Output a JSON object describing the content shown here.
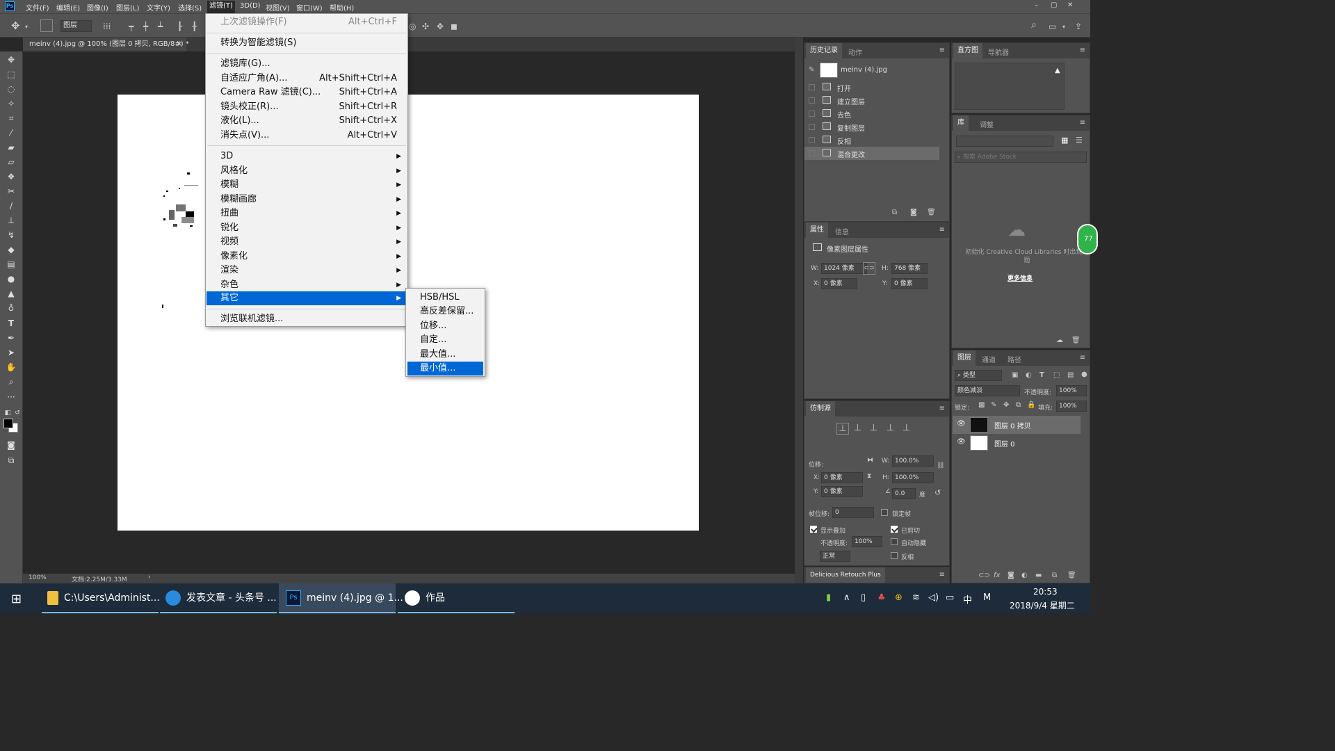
{
  "menubar": {
    "app_icon": "Ps",
    "items": [
      "文件(F)",
      "编辑(E)",
      "图像(I)",
      "图层(L)",
      "文字(Y)",
      "选择(S)",
      "滤镜(T)",
      "3D(D)",
      "视图(V)",
      "窗口(W)",
      "帮助(H)"
    ],
    "active": "滤镜(T)",
    "window_buttons": [
      "–",
      "▢",
      "✕"
    ]
  },
  "options_bar": {
    "layer_select": "图层"
  },
  "document": {
    "tab_title": "meinv (4).jpg @ 100% (图层 0 拷贝, RGB/8#) *",
    "tab_close": "×",
    "zoom": "100%",
    "doc_info": "文档:2.25M/3.33M",
    "status_arrow": "›"
  },
  "filter_menu": {
    "items": [
      {
        "label": "上次滤镜操作(F)",
        "shortcut": "Alt+Ctrl+F",
        "disabled": true
      },
      {
        "label": "转换为智能滤镜(S)",
        "shortcut": ""
      },
      {
        "label": "滤镜库(G)...",
        "shortcut": ""
      },
      {
        "label": "自适应广角(A)...",
        "shortcut": "Alt+Shift+Ctrl+A"
      },
      {
        "label": "Camera Raw 滤镜(C)...",
        "shortcut": "Shift+Ctrl+A"
      },
      {
        "label": "镜头校正(R)...",
        "shortcut": "Shift+Ctrl+R"
      },
      {
        "label": "液化(L)...",
        "shortcut": "Shift+Ctrl+X"
      },
      {
        "label": "消失点(V)...",
        "shortcut": "Alt+Ctrl+V"
      },
      {
        "label": "3D",
        "submenu": true
      },
      {
        "label": "风格化",
        "submenu": true
      },
      {
        "label": "模糊",
        "submenu": true
      },
      {
        "label": "模糊画廊",
        "submenu": true
      },
      {
        "label": "扭曲",
        "submenu": true
      },
      {
        "label": "锐化",
        "submenu": true
      },
      {
        "label": "视频",
        "submenu": true
      },
      {
        "label": "像素化",
        "submenu": true
      },
      {
        "label": "渲染",
        "submenu": true
      },
      {
        "label": "杂色",
        "submenu": true
      },
      {
        "label": "其它",
        "submenu": true,
        "highlighted": true
      },
      {
        "label": "浏览联机滤镜...",
        "shortcut": ""
      }
    ]
  },
  "other_submenu": {
    "items": [
      "HSB/HSL",
      "高反差保留...",
      "位移...",
      "自定...",
      "最大值...",
      "最小值..."
    ],
    "highlighted": "最小值..."
  },
  "history_panel": {
    "tabs": [
      "历史记录",
      "动作"
    ],
    "snapshot": "meinv (4).jpg",
    "steps": [
      "打开",
      "建立图层",
      "去色",
      "复制图层",
      "反相",
      "混合更改"
    ],
    "selected": "混合更改"
  },
  "histogram_panel": {
    "tabs": [
      "直方图",
      "导航器"
    ],
    "warning": "▲"
  },
  "library_panel": {
    "tabs": [
      "库",
      "调整"
    ],
    "search_placeholder": "搜索 Adobe Stock",
    "message": "初始化 Creative Cloud Libraries 时出现问题",
    "more_info": "更多信息"
  },
  "properties_panel": {
    "tabs": [
      "属性",
      "信息"
    ],
    "title": "像素图层属性",
    "w_label": "W:",
    "w_value": "1024 像素",
    "h_label": "H:",
    "h_value": "768 像素",
    "x_label": "X:",
    "x_value": "0 像素",
    "y_label": "Y:",
    "y_value": "0 像素"
  },
  "clone_panel": {
    "tab": "仿制源",
    "offset_label": "位移:",
    "x_label": "X:",
    "x_value": "0 像素",
    "y_label": "Y:",
    "y_value": "0 像素",
    "w_label": "W:",
    "w_value": "100.0%",
    "h_label": "H:",
    "h_value": "100.0%",
    "angle_value": "0.0",
    "angle_unit": "度",
    "frame_offset_label": "帧位移:",
    "frame_offset_value": "0",
    "lock_frame": "锁定帧",
    "show_overlay": "显示叠加",
    "clipped": "已剪切",
    "opacity_label": "不透明度:",
    "opacity_value": "100%",
    "auto_hide": "自动隐藏",
    "mode": "正常",
    "invert": "反相"
  },
  "delicious_panel": {
    "title": "Delicious Retouch Plus"
  },
  "layers_panel": {
    "tabs": [
      "图层",
      "通道",
      "路径"
    ],
    "filter_kind": "类型",
    "blend_mode": "颜色减淡",
    "opacity_label": "不透明度:",
    "opacity_value": "100%",
    "lock_label": "锁定:",
    "fill_label": "填充:",
    "fill_value": "100%",
    "layers": [
      {
        "name": "图层 0 拷贝",
        "selected": true
      },
      {
        "name": "图层 0",
        "selected": false
      }
    ],
    "footer_icons": [
      "link-icon",
      "fx-icon",
      "mask-icon",
      "adjustment-icon",
      "folder-icon",
      "new-layer-icon",
      "trash-icon"
    ]
  },
  "side_badge": "77",
  "taskbar": {
    "items": [
      {
        "label": "C:\\Users\\Administ...",
        "icon": "folder-icon"
      },
      {
        "label": "发表文章 - 头条号 ...",
        "icon": "browser-icon"
      },
      {
        "label": "meinv (4).jpg @ 1...",
        "icon": "photoshop-icon",
        "active": true
      },
      {
        "label": "作品",
        "icon": "app-icon"
      }
    ],
    "ime": "中",
    "ime2": "M",
    "time": "20:53",
    "date": "2018/9/4 星期二"
  }
}
